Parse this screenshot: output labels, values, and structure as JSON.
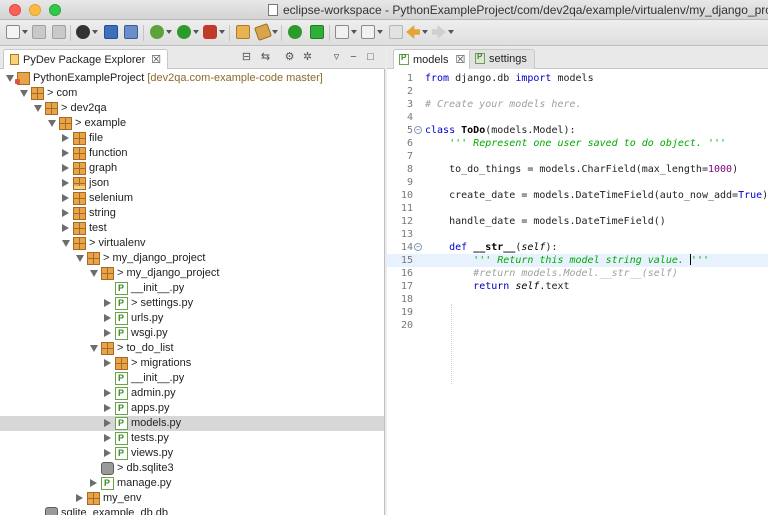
{
  "window": {
    "title": "eclipse-workspace - PythonExampleProject/com/dev2qa/example/virtualenv/my_django_pro"
  },
  "toolbar": {
    "icons": [
      "new-icon",
      "save-icon",
      "save-all-icon",
      "user-icon",
      "terminal-icon",
      "pydev-icon",
      "debug-icon",
      "run-icon",
      "external-tools-icon",
      "open-type-icon",
      "search-icon",
      "coverage-icon",
      "stop-icon",
      "next-annotation-icon",
      "prev-annotation-icon",
      "back-icon",
      "forward-icon"
    ]
  },
  "package_explorer": {
    "tab_label": "PyDev Package Explorer",
    "close_glyph": "☒",
    "tree": [
      {
        "label": "PythonExampleProject",
        "suffix": "[dev2qa.com-example-code master]",
        "depth": 0,
        "state": "open",
        "icon": "project"
      },
      {
        "label": "com",
        "prefix": ">",
        "depth": 1,
        "state": "open",
        "icon": "package"
      },
      {
        "label": "dev2qa",
        "prefix": ">",
        "depth": 2,
        "state": "open",
        "icon": "package"
      },
      {
        "label": "example",
        "prefix": ">",
        "depth": 3,
        "state": "open",
        "icon": "package"
      },
      {
        "label": "file",
        "depth": 4,
        "state": "closed",
        "icon": "package"
      },
      {
        "label": "function",
        "depth": 4,
        "state": "closed",
        "icon": "package"
      },
      {
        "label": "graph",
        "depth": 4,
        "state": "closed",
        "icon": "package"
      },
      {
        "label": "json",
        "depth": 4,
        "state": "closed",
        "icon": "package-vcs"
      },
      {
        "label": "selenium",
        "depth": 4,
        "state": "closed",
        "icon": "package"
      },
      {
        "label": "string",
        "depth": 4,
        "state": "closed",
        "icon": "package"
      },
      {
        "label": "test",
        "depth": 4,
        "state": "closed",
        "icon": "package"
      },
      {
        "label": "virtualenv",
        "prefix": ">",
        "depth": 4,
        "state": "open",
        "icon": "package"
      },
      {
        "label": "my_django_project",
        "prefix": ">",
        "depth": 5,
        "state": "open",
        "icon": "package"
      },
      {
        "label": "my_django_project",
        "prefix": ">",
        "depth": 6,
        "state": "open",
        "icon": "package"
      },
      {
        "label": "__init__.py",
        "depth": 7,
        "state": "none",
        "icon": "py"
      },
      {
        "label": "settings.py",
        "prefix": ">",
        "depth": 7,
        "state": "closed",
        "icon": "py"
      },
      {
        "label": "urls.py",
        "depth": 7,
        "state": "closed",
        "icon": "py"
      },
      {
        "label": "wsgi.py",
        "depth": 7,
        "state": "closed",
        "icon": "py"
      },
      {
        "label": "to_do_list",
        "prefix": ">",
        "depth": 6,
        "state": "open",
        "icon": "package"
      },
      {
        "label": "migrations",
        "prefix": ">",
        "depth": 7,
        "state": "closed",
        "icon": "package"
      },
      {
        "label": "__init__.py",
        "depth": 7,
        "state": "none",
        "icon": "py"
      },
      {
        "label": "admin.py",
        "depth": 7,
        "state": "closed",
        "icon": "py"
      },
      {
        "label": "apps.py",
        "depth": 7,
        "state": "closed",
        "icon": "py"
      },
      {
        "label": "models.py",
        "depth": 7,
        "state": "closed",
        "icon": "py",
        "selected": true
      },
      {
        "label": "tests.py",
        "depth": 7,
        "state": "closed",
        "icon": "py"
      },
      {
        "label": "views.py",
        "depth": 7,
        "state": "closed",
        "icon": "py"
      },
      {
        "label": "db.sqlite3",
        "prefix": ">",
        "depth": 6,
        "state": "none",
        "icon": "db"
      },
      {
        "label": "manage.py",
        "depth": 6,
        "state": "closed",
        "icon": "py"
      },
      {
        "label": "my_env",
        "depth": 5,
        "state": "closed",
        "icon": "package"
      },
      {
        "label": "sqlite_example_db.db",
        "depth": 2,
        "state": "none",
        "icon": "db"
      }
    ]
  },
  "editor": {
    "tabs": [
      {
        "label": "models",
        "close_glyph": "☒",
        "active": true
      },
      {
        "label": "settings",
        "active": false
      }
    ],
    "lines": [
      {
        "n": "1",
        "html": "<span class=\"kw\">from</span> django.db <span class=\"kw\">import</span> models"
      },
      {
        "n": "2",
        "html": ""
      },
      {
        "n": "3",
        "html": "<span class=\"cm\"># Create your models here.</span>"
      },
      {
        "n": "4",
        "html": ""
      },
      {
        "n": "5",
        "html": "<span class=\"kw\">class</span> <span class=\"fn\">ToDo</span>(models.Model):",
        "fold": true
      },
      {
        "n": "6",
        "html": "    <span class=\"doc\">''' Represent one user saved to do object. '''</span>"
      },
      {
        "n": "7",
        "html": ""
      },
      {
        "n": "8",
        "html": "    to_do_things = models.CharField(max_length=<span class=\"num\">1000</span>)"
      },
      {
        "n": "9",
        "html": ""
      },
      {
        "n": "10",
        "html": "    create_date = models.DateTimeField(auto_now_add=<span class=\"kw\">True</span>)"
      },
      {
        "n": "11",
        "html": ""
      },
      {
        "n": "12",
        "html": "    handle_date = models.DateTimeField()"
      },
      {
        "n": "13",
        "html": ""
      },
      {
        "n": "14",
        "html": "    <span class=\"kw\">def</span> <span class=\"fn\">__str__</span>(<span class=\"self\">self</span>):",
        "fold": true
      },
      {
        "n": "15",
        "html": "        <span class=\"doc\">''' Return this model string value. <span class=\"caret\"></span>'''</span>",
        "current": true
      },
      {
        "n": "16",
        "html": "        <span class=\"cm\">#return models.Model.__str__(self)</span>"
      },
      {
        "n": "17",
        "html": "        <span class=\"kw\">return</span> <span class=\"self\">self</span>.text"
      },
      {
        "n": "18",
        "html": ""
      },
      {
        "n": "19",
        "html": ""
      },
      {
        "n": "20",
        "html": ""
      }
    ]
  }
}
